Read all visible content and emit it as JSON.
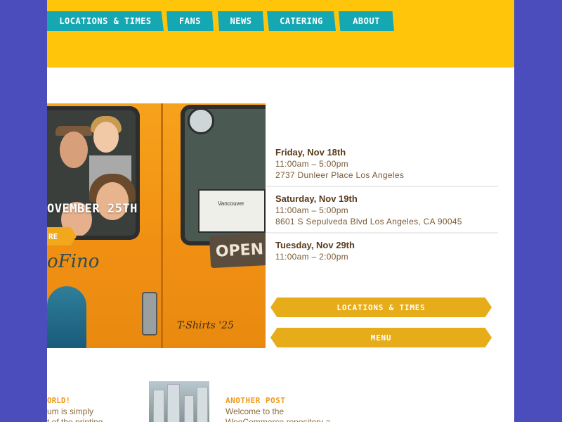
{
  "nav": {
    "items": [
      {
        "label": "Locations & Times"
      },
      {
        "label": "Fans"
      },
      {
        "label": "News"
      },
      {
        "label": "Catering"
      },
      {
        "label": "About"
      }
    ]
  },
  "hero": {
    "overlay_text": "OVEMBER 25TH",
    "overlay_button": "RE",
    "brand_text": "oFino",
    "open_sign": "OPEN",
    "card_text": "Vancouver",
    "graffiti": "T-Shirts '25"
  },
  "schedule": [
    {
      "date": "Friday, Nov 18th",
      "time": "11:00am – 5:00pm",
      "address": "2737 Dunleer Place Los Angeles"
    },
    {
      "date": "Saturday, Nov 19th",
      "time": "11:00am – 5:00pm",
      "address": "8601 S Sepulveda Blvd Los Angeles, CA 90045"
    },
    {
      "date": "Tuesday, Nov 29th",
      "time": "11:00am – 2:00pm",
      "address": ""
    }
  ],
  "cta": {
    "locations_label": "Locations & Times",
    "menu_label": "Menu"
  },
  "posts": {
    "left_title": "ORLD!",
    "left_text": "um is simply\nt of the printing",
    "right_title": "Another Post",
    "right_text": "Welcome to the\nWooCommerce repository a"
  },
  "colors": {
    "background": "#4b4dbd",
    "header": "#fec50b",
    "nav_tab": "#15a8b3",
    "cta": "#e6ac1a",
    "post_title": "#ef9a15"
  }
}
